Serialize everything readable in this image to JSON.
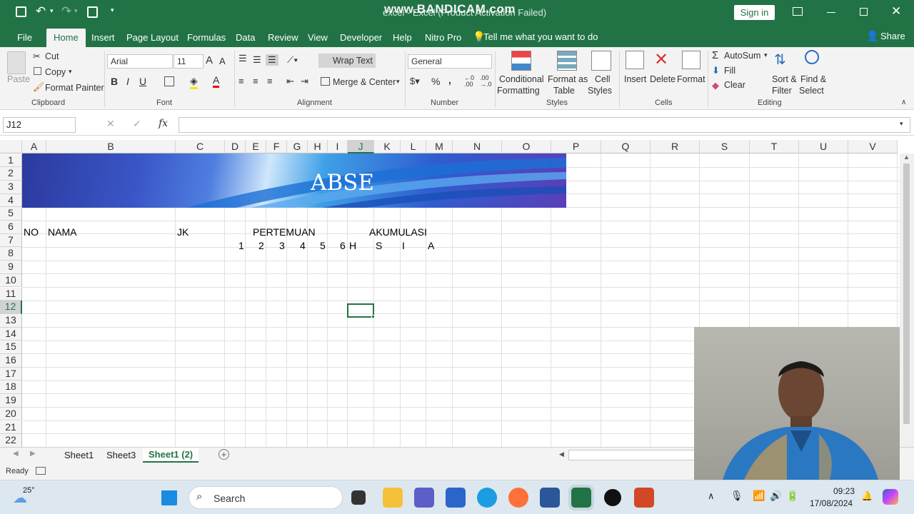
{
  "titlebar": {
    "title": "excel - Excel (Product Activation Failed)",
    "watermark": "www.BANDICAM.com",
    "sign_in": "Sign in"
  },
  "ribbon_tabs": [
    "File",
    "Home",
    "Insert",
    "Page Layout",
    "Formulas",
    "Data",
    "Review",
    "View",
    "Developer",
    "Help",
    "Nitro Pro"
  ],
  "tell_me": "Tell me what you want to do",
  "share": "Share",
  "clipboard": {
    "paste": "Paste",
    "cut": "Cut",
    "copy": "Copy",
    "format_painter": "Format Painter",
    "label": "Clipboard"
  },
  "font": {
    "name": "Arial",
    "size": "11",
    "label": "Font",
    "bold": "B",
    "italic": "I",
    "underline": "U"
  },
  "alignment": {
    "wrap": "Wrap Text",
    "merge": "Merge & Center",
    "label": "Alignment"
  },
  "number": {
    "format": "General",
    "label": "Number",
    "percent": "%",
    "comma": ","
  },
  "styles": {
    "conditional": "Conditional",
    "conditional2": "Formatting",
    "format_as": "Format as",
    "table": "Table",
    "cell": "Cell",
    "styles_word": "Styles",
    "label": "Styles"
  },
  "cells": {
    "insert": "Insert",
    "delete": "Delete",
    "format": "Format",
    "label": "Cells"
  },
  "editing": {
    "autosum": "AutoSum",
    "fill": "Fill",
    "clear": "Clear",
    "sort": "Sort &",
    "filter": "Filter",
    "find": "Find &",
    "select": "Select",
    "label": "Editing"
  },
  "formula_bar": {
    "name_box": "J12",
    "fx": "fx",
    "value": ""
  },
  "columns": [
    "A",
    "B",
    "C",
    "D",
    "E",
    "F",
    "G",
    "H",
    "I",
    "J",
    "K",
    "L",
    "M",
    "N",
    "O",
    "P",
    "Q",
    "R",
    "S",
    "T",
    "U",
    "V"
  ],
  "rows": [
    "1",
    "2",
    "3",
    "4",
    "5",
    "6",
    "7",
    "8",
    "9",
    "10",
    "11",
    "12",
    "13",
    "14",
    "15",
    "16",
    "17",
    "18",
    "19",
    "20",
    "21",
    "22"
  ],
  "banner_text": "ABSE",
  "sheet": {
    "no": "NO",
    "nama": "NAMA",
    "jk": "JK",
    "pertemuan": "PERTEMUAN",
    "akumulasi": "AKUMULASI",
    "meetings": [
      "1",
      "2",
      "3",
      "4",
      "5",
      "6"
    ],
    "akum": [
      "H",
      "S",
      "I",
      "A"
    ]
  },
  "sheet_tabs": [
    "Sheet1",
    "Sheet3",
    "Sheet1 (2)"
  ],
  "status": "Ready",
  "taskbar": {
    "temp": "25°",
    "search": "Search",
    "time": "09:23",
    "date": "17/08/2024"
  },
  "colors": {
    "excel_green": "#217346",
    "banner_dark": "#2b3a9e",
    "banner_light": "#3fa0e6"
  }
}
